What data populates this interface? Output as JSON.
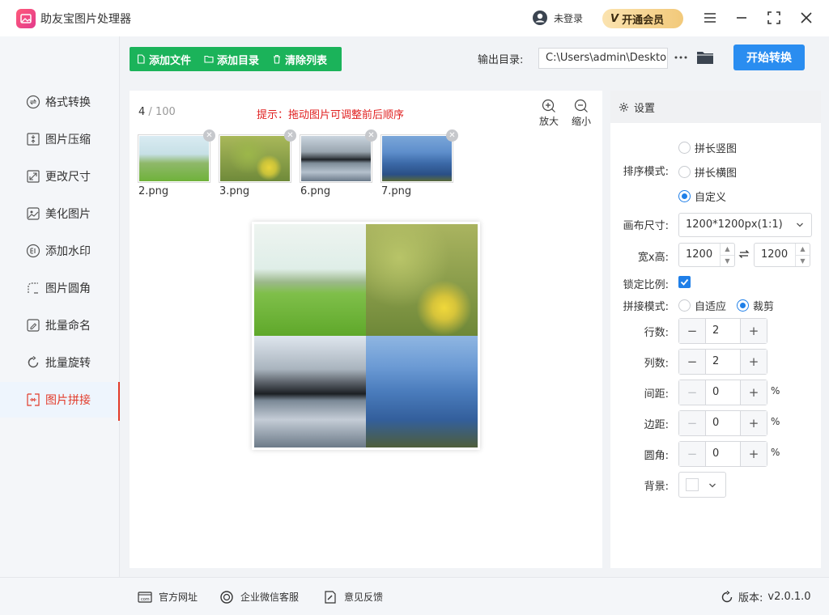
{
  "app": {
    "title": "助友宝图片处理器",
    "login": "未登录",
    "vip_badge": "V",
    "vip": "开通会员"
  },
  "sidebar": {
    "items": [
      {
        "label": "格式转换"
      },
      {
        "label": "图片压缩"
      },
      {
        "label": "更改尺寸"
      },
      {
        "label": "美化图片"
      },
      {
        "label": "添加水印"
      },
      {
        "label": "图片圆角"
      },
      {
        "label": "批量命名"
      },
      {
        "label": "批量旋转"
      },
      {
        "label": "图片拼接"
      }
    ]
  },
  "toolbar": {
    "add_file": "添加文件",
    "add_dir": "添加目录",
    "clear": "清除列表",
    "output_label": "输出目录:",
    "output_path": "C:\\Users\\admin\\Desktop",
    "start": "开始转换"
  },
  "main": {
    "count": "4",
    "count_sep": " / ",
    "count_total": "100",
    "hint": "提示：拖动图片可调整前后顺序",
    "zoom_in": "放大",
    "zoom_out": "缩小",
    "thumbnails": [
      {
        "name": "2.png"
      },
      {
        "name": "3.png"
      },
      {
        "name": "6.png"
      },
      {
        "name": "7.png"
      }
    ]
  },
  "settings": {
    "title": "设置",
    "sort_label": "排序模式:",
    "sort_options": [
      "拼长竖图",
      "拼长横图",
      "自定义"
    ],
    "canvas_label": "画布尺寸:",
    "canvas_value": "1200*1200px(1:1)",
    "wh_label": "宽x高:",
    "width": "1200",
    "height": "1200",
    "lock_label": "锁定比例:",
    "mode_label": "拼接模式:",
    "mode_options": [
      "自适应",
      "裁剪"
    ],
    "rows_label": "行数:",
    "rows": "2",
    "cols_label": "列数:",
    "cols": "2",
    "gap_label": "间距:",
    "gap": "0",
    "margin_label": "边距:",
    "margin": "0",
    "radius_label": "圆角:",
    "radius": "0",
    "pct": "%",
    "bg_label": "背景:"
  },
  "footer": {
    "site": "官方网址",
    "wechat": "企业微信客服",
    "feedback": "意见反馈",
    "version_label": "版本:",
    "version": "v2.0.1.0"
  },
  "colors": {
    "accent": "#2a8df0",
    "green": "#1bb35a",
    "active": "#e23b2a"
  }
}
